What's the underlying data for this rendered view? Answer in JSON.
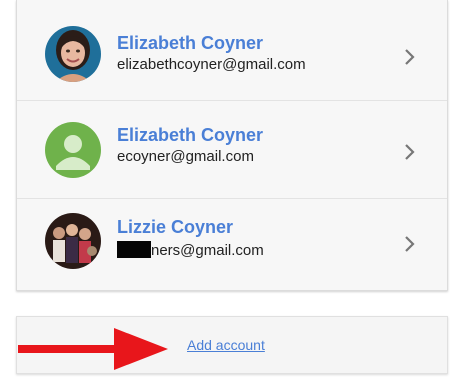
{
  "accounts": [
    {
      "name": "Elizabeth Coyner",
      "email": "elizabethcoyner@gmail.com",
      "avatar": "profile-photo"
    },
    {
      "name": "Elizabeth Coyner",
      "email": "ecoyner@gmail.com",
      "avatar": "default-person-icon"
    },
    {
      "name": "Lizzie Coyner",
      "email_visible_suffix": "ners@gmail.com",
      "email_redacted": true,
      "avatar": "group-photo"
    }
  ],
  "add_account": {
    "label": "Add account"
  },
  "annotation": {
    "arrow_icon": "red-arrow-right",
    "arrow_color": "#e8161b"
  },
  "colors": {
    "link_blue": "#4a7fd6",
    "default_avatar_green": "#6fb24b",
    "row_background": "#f7f7f7"
  }
}
